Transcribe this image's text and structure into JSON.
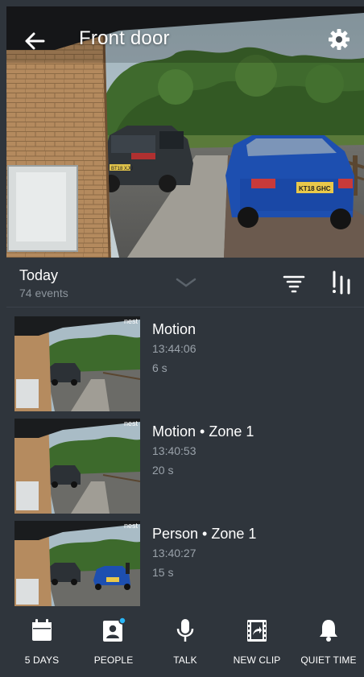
{
  "header": {
    "title": "Front door"
  },
  "timeline": {
    "day": "Today",
    "count": "74 events"
  },
  "events": [
    {
      "title": "Motion",
      "time": "13:44:06",
      "duration": "6 s"
    },
    {
      "title": "Motion • Zone 1",
      "time": "13:40:53",
      "duration": "20 s"
    },
    {
      "title": "Person • Zone 1",
      "time": "13:40:27",
      "duration": "15 s"
    }
  ],
  "thumb_logo": "nest",
  "feed": {
    "plate_front": "KT18 GHC",
    "plate_rear": "BT18 XJU"
  },
  "bottom_bar": [
    {
      "label": "5 DAYS",
      "icon": "calendar-icon"
    },
    {
      "label": "PEOPLE",
      "icon": "person-icon",
      "badge": true
    },
    {
      "label": "TALK",
      "icon": "microphone-icon"
    },
    {
      "label": "NEW CLIP",
      "icon": "clip-icon"
    },
    {
      "label": "QUIET TIME",
      "icon": "bell-icon"
    }
  ],
  "colors": {
    "background": "#2f353c",
    "muted_text": "#9aa2aa",
    "badge": "#29b6f6"
  }
}
